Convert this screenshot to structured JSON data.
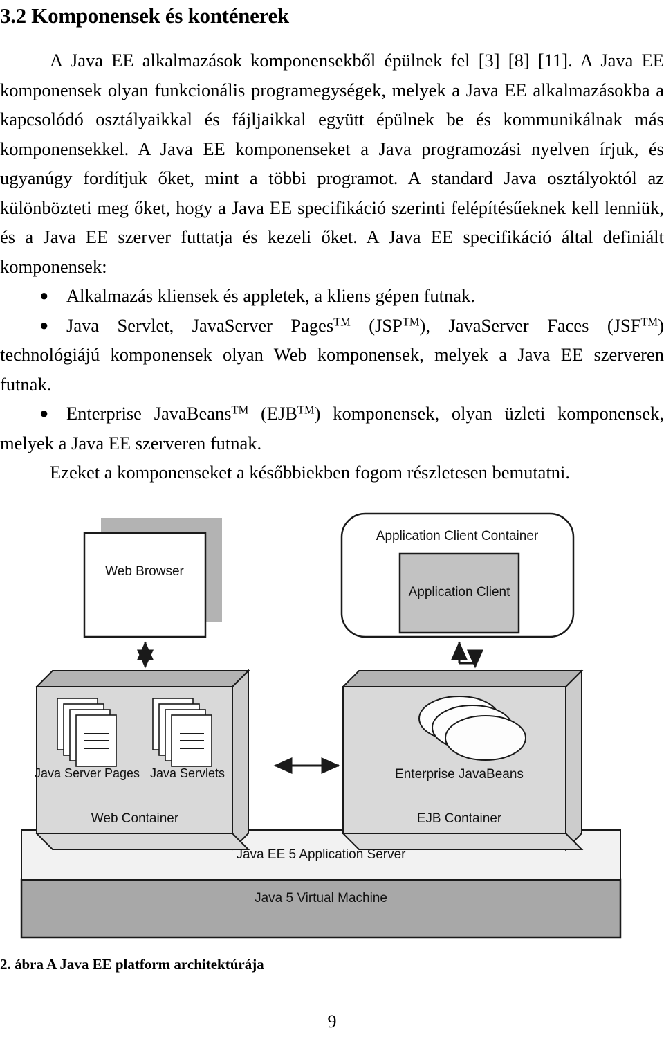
{
  "document": {
    "heading": "3.2 Komponensek és konténerek",
    "paragraph_1_parts": {
      "a": "A Java EE alkalmazások komponensekből épülnek fel [3] [8] [11]. A Java EE komponensek olyan funkcionális programegységek, melyek a Java EE alkalmazásokba a kapcsolódó osztályaikkal és fájljaikkal együtt épülnek be és kommunikálnak más komponensekkel. A Java EE komponenseket a Java programozási nyelven írjuk, és ugyanúgy fordítjuk őket, mint a többi programot. A standard Java osztályoktól az különbözteti meg őket, hogy a Java EE specifikáció szerinti felépítésűeknek kell lenniük, és a Java EE szerver futtatja és kezeli őket. A Java EE specifikáció által definiált komponensek:"
    },
    "bullets": [
      {
        "id": "bullet-app-clients",
        "text": "Alkalmazás kliensek és appletek, a kliens gépen futnak."
      },
      {
        "id": "bullet-web-components",
        "pre": "Java Servlet, JavaServer Pages",
        "sup1": "TM",
        "mid1": " (JSP",
        "sup2": "TM",
        "mid2": "), JavaServer Faces (JSF",
        "sup3": "TM",
        "post": ") technológiájú komponensek olyan Web komponensek, melyek a Java EE szerveren futnak."
      },
      {
        "id": "bullet-ejb-components",
        "pre": "Enterprise JavaBeans",
        "sup1": "TM",
        "mid1": " (EJB",
        "sup2": "TM",
        "post": ") komponensek, olyan üzleti komponensek, melyek a Java EE szerveren futnak."
      }
    ],
    "closing_paragraph": "Ezeket a komponenseket a későbbiekben fogom részletesen bemutatni.",
    "figure_caption": "2. ábra A Java EE platform architektúrája",
    "page_number": "9"
  },
  "figure": {
    "name": "java-ee-platform-architecture",
    "labels": {
      "web_browser": "Web Browser",
      "application_client_container": "Application Client Container",
      "application_client": "Application Client",
      "java_server_pages": "Java Server Pages",
      "java_servlets": "Java Servlets",
      "web_container": "Web Container",
      "enterprise_javabeans": "Enterprise JavaBeans",
      "ejb_container": "EJB Container",
      "app_server": "Java EE 5 Application Server",
      "jvm": "Java 5 Virtual Machine"
    },
    "colors": {
      "shadow_gray": "#b3b3b3",
      "container_fill": "#d9d9d9",
      "container_side": "#cccccc",
      "app_client_fill": "#c2c2c2",
      "app_server_fill": "#f2f2f2",
      "jvm_fill": "#a8a8a8",
      "stroke": "#1a1a1a",
      "white": "#ffffff"
    }
  }
}
